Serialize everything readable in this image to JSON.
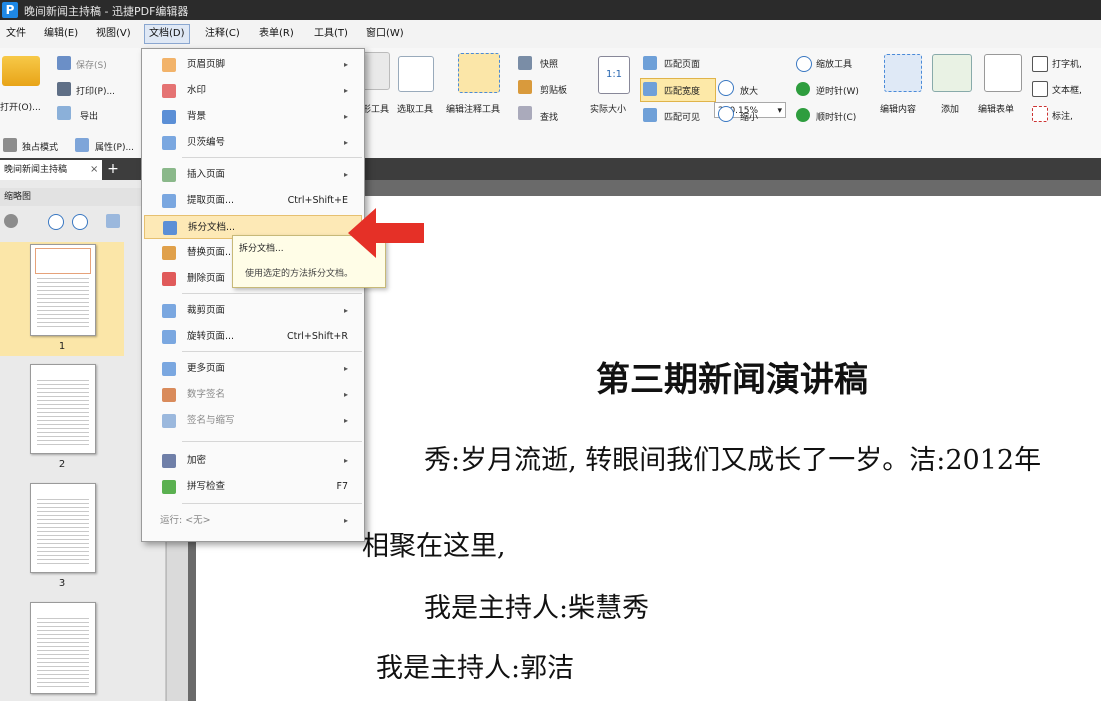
{
  "window": {
    "title": "晚间新闻主持稿 - 迅捷PDF编辑器"
  },
  "menubar": [
    "文件",
    "编辑(E)",
    "视图(V)",
    "文档(D)",
    "注释(C)",
    "表单(R)",
    "工具(T)",
    "窗口(W)"
  ],
  "ribbon": {
    "open": "打开(O)...",
    "save": "保存(S)",
    "print": "打印(P)...",
    "export": "导出",
    "hand_tool": "形工具",
    "select_tool": "选取工具",
    "edit_annot_tool": "编辑注释工具",
    "snapshot": "快照",
    "clipboard": "剪贴板",
    "find": "查找",
    "actual_size": "实际大小",
    "fit_page": "匹配页面",
    "fit_width": "匹配宽度",
    "fit_visible": "匹配可见",
    "zoom_value": "210.15%",
    "zoom_in": "放大",
    "zoom_out": "缩小",
    "zoom_tool": "缩放工具",
    "rotate_ccw": "逆时针(W)",
    "rotate_cw": "顺时针(C)",
    "edit_content": "编辑内容",
    "add": "添加",
    "edit_form": "编辑表单",
    "typewriter": "打字机,",
    "textbox": "文本框,",
    "callout": "标注,",
    "exclusive_mode": "独占模式",
    "properties": "属性(P)..."
  },
  "tabs": {
    "doc_tab": "晚间新闻主持稿",
    "close": "×",
    "add": "+"
  },
  "leftpanel": {
    "header": "缩略图",
    "thumbnails": [
      {
        "label": "1"
      },
      {
        "label": "2"
      },
      {
        "label": "3"
      }
    ]
  },
  "dropdown": {
    "items": [
      {
        "label": "页眉页脚",
        "shortcut": "",
        "submenu": true
      },
      {
        "label": "水印",
        "shortcut": "",
        "submenu": true
      },
      {
        "label": "背景",
        "shortcut": "",
        "submenu": true
      },
      {
        "label": "贝茨编号",
        "shortcut": "",
        "submenu": true
      },
      {
        "label": "插入页面",
        "shortcut": "",
        "submenu": true
      },
      {
        "label": "提取页面...",
        "shortcut": "Ctrl+Shift+E",
        "submenu": false
      },
      {
        "label": "拆分文档...",
        "shortcut": "",
        "submenu": false
      },
      {
        "label": "替换页面...",
        "shortcut": "",
        "submenu": false
      },
      {
        "label": "删除页面",
        "shortcut": "",
        "submenu": false
      },
      {
        "label": "裁剪页面",
        "shortcut": "",
        "submenu": true
      },
      {
        "label": "旋转页面...",
        "shortcut": "Ctrl+Shift+R",
        "submenu": false
      },
      {
        "label": "更多页面",
        "shortcut": "",
        "submenu": true
      },
      {
        "label": "数字签名",
        "shortcut": "",
        "submenu": true
      },
      {
        "label": "签名与缩写",
        "shortcut": "",
        "submenu": true
      },
      {
        "label": "加密",
        "shortcut": "",
        "submenu": true
      },
      {
        "label": "拼写检查",
        "shortcut": "F7",
        "submenu": false
      },
      {
        "label": "运行: <无>",
        "shortcut": "",
        "submenu": true
      }
    ]
  },
  "tooltip": {
    "title": "拆分文档...",
    "desc": "使用选定的方法拆分文档。"
  },
  "document": {
    "title": "第三期新闻演讲稿",
    "line1": "秀:岁月流逝, 转眼间我们又成长了一岁。洁:2012年",
    "line2": "相聚在这里,",
    "line3": "我是主持人:柴慧秀",
    "line4": "我是主持人:郭洁"
  },
  "colors": {
    "accent": "#1e88e5",
    "highlight": "#fde9b6",
    "arrow": "#e53027"
  }
}
